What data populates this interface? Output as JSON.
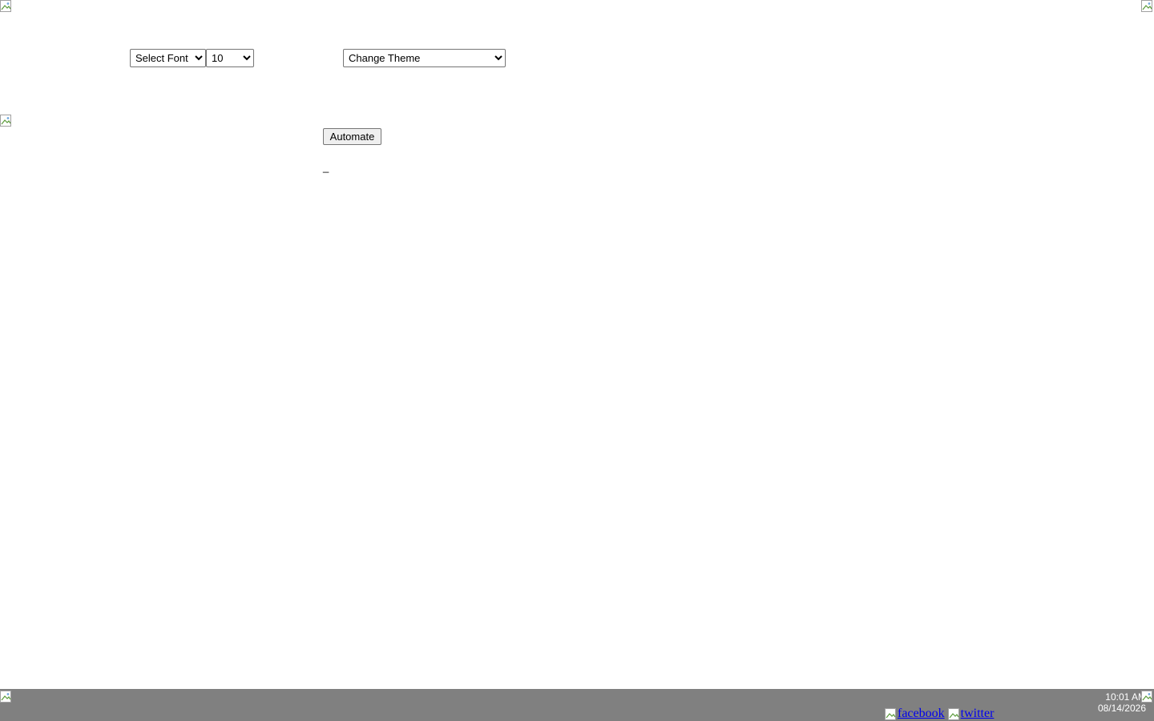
{
  "toolbar": {
    "font_select": {
      "selected": "Select Font",
      "options": [
        "Select Font"
      ]
    },
    "size_select": {
      "selected": "10",
      "options": [
        "10"
      ]
    },
    "theme_select": {
      "selected": "Change Theme",
      "options": [
        "Change Theme"
      ]
    }
  },
  "main": {
    "automate_label": "Automate",
    "cursor_text": "_"
  },
  "taskbar": {
    "time": "10:01 AM",
    "date": "08/14/2026",
    "facebook_label": "facebook",
    "twitter_label": "twitter"
  },
  "colors": {
    "taskbar_bg": "#808080",
    "link": "#0000ee"
  },
  "icons": {
    "broken_image": "broken-image-icon"
  }
}
